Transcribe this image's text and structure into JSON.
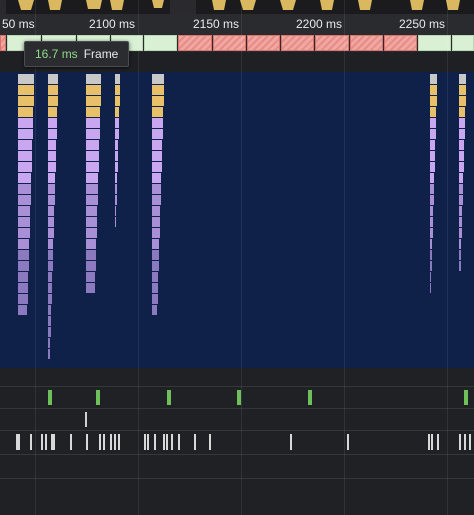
{
  "ruler": {
    "ticks": [
      {
        "label": "50 ms",
        "value_ms": 2050
      },
      {
        "label": "2100 ms",
        "value_ms": 2100
      },
      {
        "label": "2150 ms",
        "value_ms": 2150
      },
      {
        "label": "2200 ms",
        "value_ms": 2200
      },
      {
        "label": "2250 ms",
        "value_ms": 2250
      }
    ]
  },
  "tooltip": {
    "duration": "16.7 ms",
    "label": "Frame"
  },
  "colors": {
    "frame_good": "#d9f0d5",
    "frame_dropped": "#e88c86",
    "flame_background": "#0f2149",
    "task_gray": "#c8c8c8",
    "scripting_yellow": "#e8c06a",
    "rendering_purple": "#c8a6f0",
    "raster_green": "#6fbf5a",
    "tooltip_duration": "#8fd98a"
  }
}
